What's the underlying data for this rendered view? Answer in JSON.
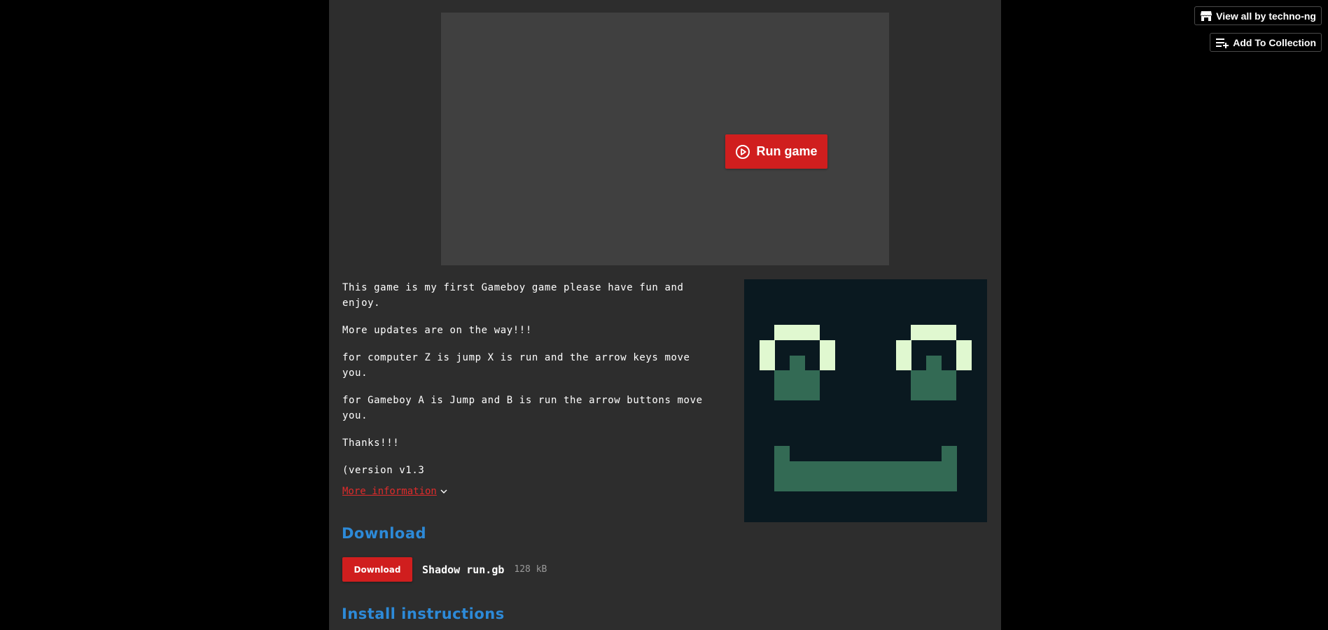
{
  "header": {
    "view_all_label": "View all by techno-ng",
    "add_collection_label": "Add To Collection"
  },
  "game": {
    "run_label": "Run game"
  },
  "description": {
    "paragraphs": [
      "This game is my first Gameboy game please have fun and enjoy.",
      "More updates are on the way!!!",
      "for computer Z is jump X is run and the arrow keys move you.",
      "for Gameboy A is Jump and B is run the arrow buttons move you.",
      "Thanks!!!",
      "(version v1.3"
    ],
    "more_info_label": "More information"
  },
  "download": {
    "title": "Download",
    "button_label": "Download",
    "file_name": "Shadow run.gb",
    "file_size": "128 kB"
  },
  "install": {
    "title": "Install instructions"
  },
  "colors": {
    "page_bg": "#000000",
    "column_bg": "#2d2d2d",
    "embed_bg": "#404040",
    "accent_red": "#d01e1e",
    "link_red": "#e02b2b",
    "heading_blue": "#2d8ad8",
    "sprite_dark": "#0a1920",
    "sprite_green": "#336a54",
    "sprite_light": "#e0f8d0"
  },
  "icons": {
    "run": "play-circle-icon",
    "more_info": "chevron-down-icon",
    "view_all": "itchio-store-icon",
    "add_collection": "playlist-add-icon"
  }
}
